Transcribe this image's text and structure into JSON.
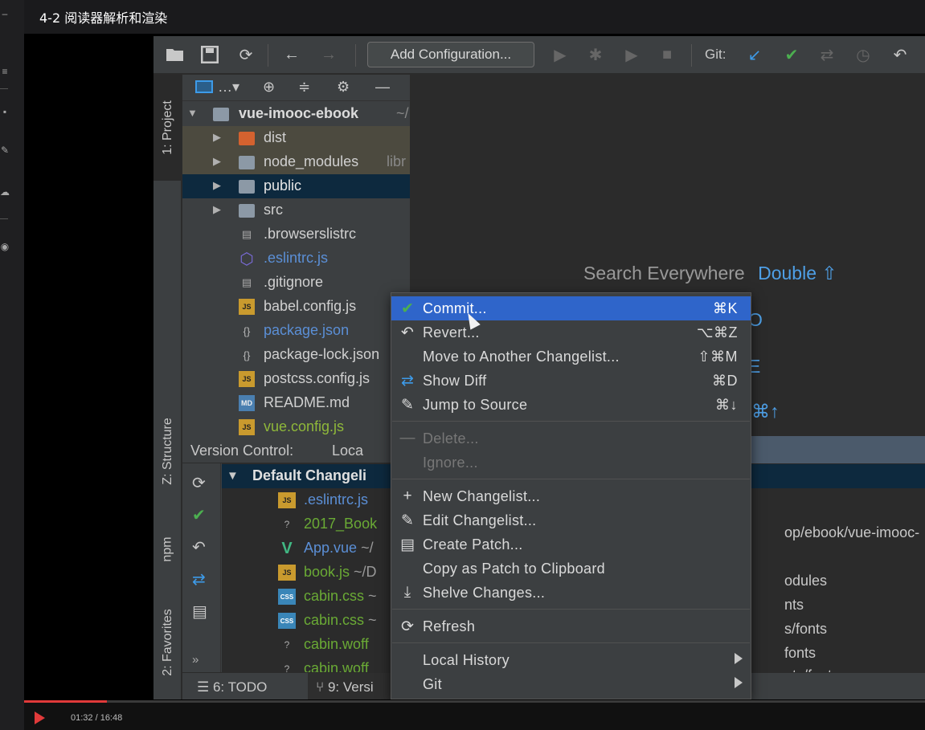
{
  "video": {
    "title": "4-2 阅读器解析和渲染",
    "time": "01:32 / 16:48",
    "progress": 0.092
  },
  "toolbar": {
    "add_configuration": "Add Configuration...",
    "git_label": "Git:"
  },
  "side_tabs": {
    "project": "1: Project",
    "structure": "Z: Structure",
    "npm": "npm",
    "favorites": "2: Favorites"
  },
  "project_tree": {
    "root": "vue-imooc-ebook",
    "root_path": "~/",
    "items": [
      {
        "label": "dist",
        "extra": ""
      },
      {
        "label": "node_modules",
        "extra": "libr"
      },
      {
        "label": "public",
        "extra": ""
      },
      {
        "label": "src",
        "extra": ""
      },
      {
        "label": ".browserslistrc",
        "extra": ""
      },
      {
        "label": ".eslintrc.js",
        "extra": ""
      },
      {
        "label": ".gitignore",
        "extra": ""
      },
      {
        "label": "babel.config.js",
        "extra": ""
      },
      {
        "label": "package.json",
        "extra": ""
      },
      {
        "label": "package-lock.json",
        "extra": ""
      },
      {
        "label": "postcss.config.js",
        "extra": ""
      },
      {
        "label": "README.md",
        "extra": ""
      },
      {
        "label": "vue.config.js",
        "extra": ""
      }
    ]
  },
  "editor_hints": {
    "search_everywhere": "Search Everywhere",
    "double_key": "Double ⇧",
    "frag1": "O",
    "frag2": "E",
    "frag3": "⌘↑"
  },
  "version_control": {
    "title": "Version Control:",
    "local_tab": "Loca",
    "group": "Default Changeli",
    "files": [
      {
        "label": ".eslintrc.js",
        "extra": ""
      },
      {
        "label": "2017_Book",
        "extra": ""
      },
      {
        "label": "App.vue",
        "extra": " ~/"
      },
      {
        "label": "book.js",
        "extra": " ~/D"
      },
      {
        "label": "cabin.css",
        "extra": " ~"
      },
      {
        "label": "cabin.css",
        "extra": " ~"
      },
      {
        "label": "cabin.woff",
        "extra": ""
      },
      {
        "label": "cabin.woff",
        "extra": ""
      }
    ],
    "right_fragments": [
      "op/ebook/vue-imooc-",
      "odules",
      "nts",
      "s/fonts",
      "fonts",
      "ets/fonts"
    ]
  },
  "bottom_tabs": {
    "todo": "6: TODO",
    "version": "9: Versi"
  },
  "context_menu": {
    "items": [
      {
        "label": "Commit...",
        "shortcut": "⌘K"
      },
      {
        "label": "Revert...",
        "shortcut": "⌥⌘Z"
      },
      {
        "label": "Move to Another Changelist...",
        "shortcut": "⇧⌘M"
      },
      {
        "label": "Show Diff",
        "shortcut": "⌘D"
      },
      {
        "label": "Jump to Source",
        "shortcut": "⌘↓"
      },
      {
        "label": "Delete...",
        "shortcut": ""
      },
      {
        "label": "Ignore...",
        "shortcut": ""
      },
      {
        "label": "New Changelist...",
        "shortcut": ""
      },
      {
        "label": "Edit Changelist...",
        "shortcut": ""
      },
      {
        "label": "Create Patch...",
        "shortcut": ""
      },
      {
        "label": "Copy as Patch to Clipboard",
        "shortcut": ""
      },
      {
        "label": "Shelve Changes...",
        "shortcut": ""
      },
      {
        "label": "Refresh",
        "shortcut": ""
      },
      {
        "label": "Local History",
        "shortcut": ""
      },
      {
        "label": "Git",
        "shortcut": ""
      }
    ]
  },
  "colors": {
    "highlight": "#2f65ca",
    "accent_blue": "#4e9fe6",
    "git_green": "#4caf50",
    "progress_red": "#e03a3a"
  }
}
